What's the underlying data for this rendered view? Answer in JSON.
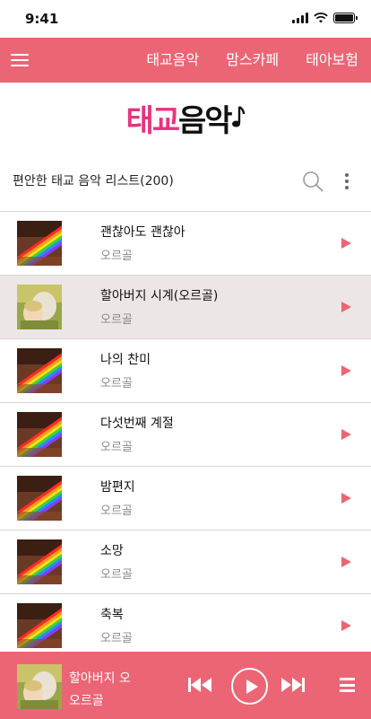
{
  "status_bar": {
    "time": "9:41",
    "icons": [
      "signal-icon",
      "wifi-icon",
      "battery-icon"
    ]
  },
  "nav": {
    "menu_icon": "menu-icon",
    "tabs": [
      {
        "label": "태교음악"
      },
      {
        "label": "맘스카페"
      },
      {
        "label": "태아보험"
      }
    ]
  },
  "logo": {
    "part_a": "태교",
    "part_b": "음악",
    "colors": {
      "accent": "#e8337d",
      "dark": "#111111"
    }
  },
  "list": {
    "title": "편안한 태교 음악 리스트(200)",
    "search_icon": "search-icon",
    "more_icon": "more-vertical-icon",
    "songs": [
      {
        "title": "괜찮아도 괜찮아",
        "artist": "오르골",
        "thumb": "rainbow",
        "active": false
      },
      {
        "title": "할아버지 시계(오르골)",
        "artist": "오르골",
        "thumb": "portrait",
        "active": true
      },
      {
        "title": "나의 찬미",
        "artist": "오르골",
        "thumb": "rainbow",
        "active": false
      },
      {
        "title": "다섯번째 계절",
        "artist": "오르골",
        "thumb": "rainbow",
        "active": false
      },
      {
        "title": "밤편지",
        "artist": "오르골",
        "thumb": "rainbow",
        "active": false
      },
      {
        "title": "소망",
        "artist": "오르골",
        "thumb": "rainbow",
        "active": false
      },
      {
        "title": "축복",
        "artist": "오르골",
        "thumb": "rainbow",
        "active": false
      }
    ]
  },
  "player": {
    "title": "할아버지 오",
    "artist": "오르골",
    "icons": [
      "prev-icon",
      "play-icon",
      "next-icon",
      "queue-icon"
    ]
  },
  "colors": {
    "brand": "#ec6575",
    "active_row": "#ece6e6"
  }
}
